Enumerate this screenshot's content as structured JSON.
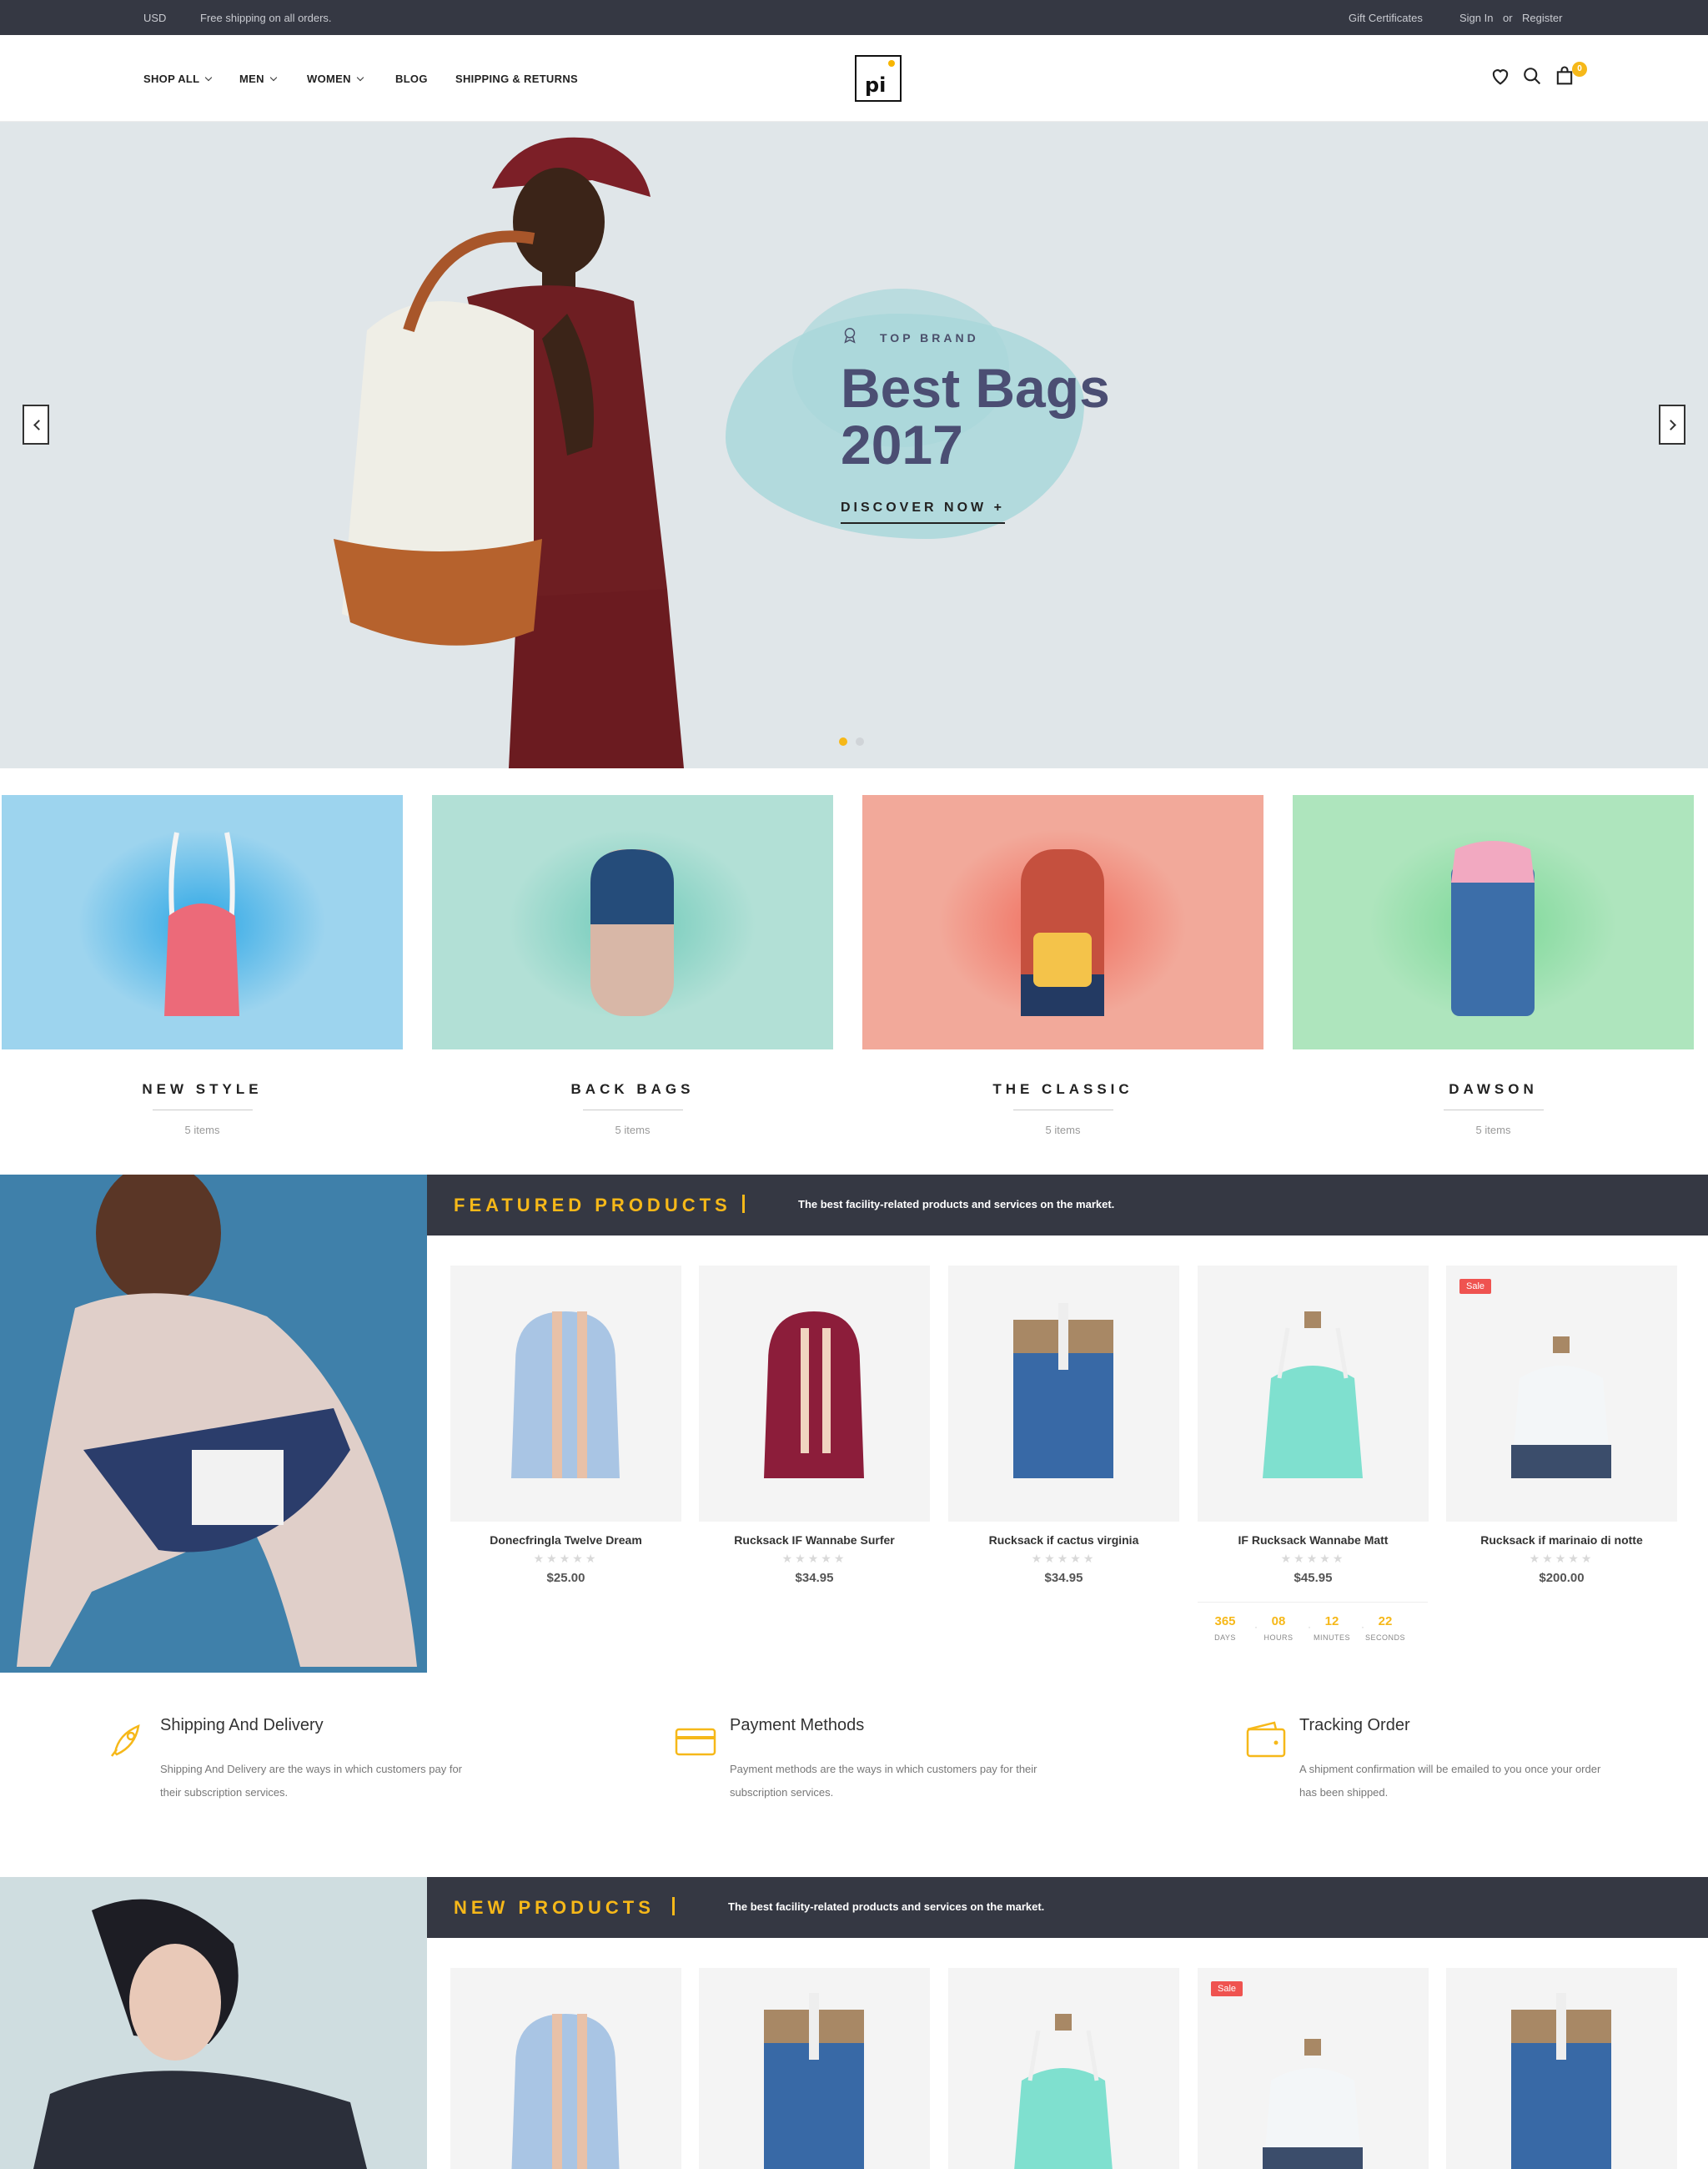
{
  "topbar": {
    "currency": "USD",
    "shipping_note": "Free shipping on all orders.",
    "gift": "Gift Certificates",
    "signin": "Sign In",
    "or": "or",
    "register": "Register"
  },
  "header": {
    "nav": [
      "SHOP ALL",
      "MEN",
      "WOMEN",
      "BLOG",
      "SHIPPING & RETURNS"
    ],
    "logo": "pi",
    "cart_count": "0",
    "icons": [
      "heart-icon",
      "search-icon",
      "bag-icon"
    ],
    "accent": "#f6b819"
  },
  "hero": {
    "tag": "TOP BRAND",
    "title": "Best Bags 2017",
    "cta": "DISCOVER NOW +"
  },
  "collections": [
    {
      "name": "NEW STYLE",
      "count": "5 items",
      "bg": "#9dd4ee"
    },
    {
      "name": "BACK BAGS",
      "count": "5 items",
      "bg": "#b2e0d6"
    },
    {
      "name": "THE CLASSIC",
      "count": "5 items",
      "bg": "#f2a99a"
    },
    {
      "name": "DAWSON",
      "count": "5 items",
      "bg": "#aee5bd"
    }
  ],
  "featured": {
    "title": "FEATURED PRODUCTS",
    "subtitle": "The best facility-related products and services on the market.",
    "products": [
      {
        "name": "Donecfringla Twelve Dream",
        "price": "$25.00",
        "stars": "★★★★★"
      },
      {
        "name": "Rucksack IF Wannabe Surfer",
        "price": "$34.95",
        "stars": "★★★★★"
      },
      {
        "name": "Rucksack if cactus virginia",
        "price": "$34.95",
        "stars": "★★★★★"
      },
      {
        "name": "IF Rucksack Wannabe Matt",
        "price": "$45.95",
        "stars": "★★★★★"
      },
      {
        "name": "Rucksack if marinaio di notte",
        "price": "$200.00",
        "stars": "★★★★★",
        "badge": "Sale"
      }
    ],
    "countdown": [
      {
        "num": "365",
        "label": "DAYS"
      },
      {
        "num": "08",
        "label": "HOURS"
      },
      {
        "num": "12",
        "label": "MINUTES"
      },
      {
        "num": "22",
        "label": "SECONDS"
      }
    ]
  },
  "features": [
    {
      "title": "Shipping And Delivery",
      "desc": "Shipping And Delivery are the ways in which customers pay for their subscription services.",
      "icon": "rocket-icon"
    },
    {
      "title": "Payment Methods",
      "desc": "Payment methods are the ways in which customers pay for their subscription services.",
      "icon": "credit-card-icon"
    },
    {
      "title": "Tracking Order",
      "desc": "A shipment confirmation will be emailed to you once your order has been shipped.",
      "icon": "wallet-icon"
    }
  ],
  "new_products": {
    "title": "NEW PRODUCTS",
    "subtitle": "The best facility-related products and services on the market.",
    "badge": "Sale"
  }
}
